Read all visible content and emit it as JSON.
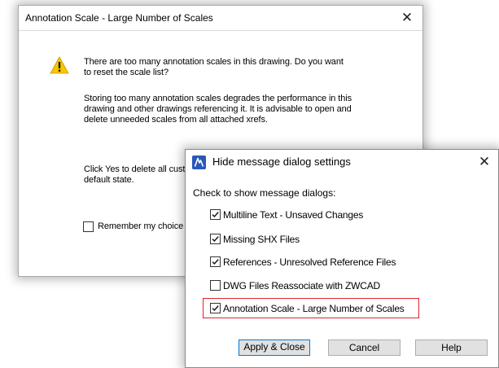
{
  "colors": {
    "highlight": "#e0232a",
    "default_button_border": "#0078d7",
    "warning": "#f7c600"
  },
  "annotation_dialog": {
    "title": "Annotation Scale - Large Number of Scales",
    "close_glyph": "✕",
    "message_main": "There are too many annotation scales in this drawing. Do you want to reset the scale list?",
    "message_detail": "Storing too many annotation scales degrades the performance in this drawing and other drawings referencing it. It is advisable to open and delete unneeded scales from all attached xrefs.",
    "message_yes": "Click Yes to delete all cust default state.",
    "remember_label": "Remember my choice a",
    "remember_checked": false,
    "icon": "warning-triangle-icon"
  },
  "hide_dialog": {
    "title": "Hide message dialog settings",
    "close_glyph": "✕",
    "icon": "zwcad-app-icon",
    "section_label": "Check to show message dialogs:",
    "options": [
      {
        "label": "Multiline Text - Unsaved Changes",
        "checked": true
      },
      {
        "label": "Missing SHX Files",
        "checked": true
      },
      {
        "label": "References - Unresolved Reference Files",
        "checked": true
      },
      {
        "label": "DWG Files Reassociate with ZWCAD",
        "checked": false
      },
      {
        "label": "Annotation Scale - Large Number of Scales",
        "checked": true
      }
    ],
    "buttons": {
      "apply": "Apply & Close",
      "cancel": "Cancel",
      "help": "Help"
    }
  }
}
